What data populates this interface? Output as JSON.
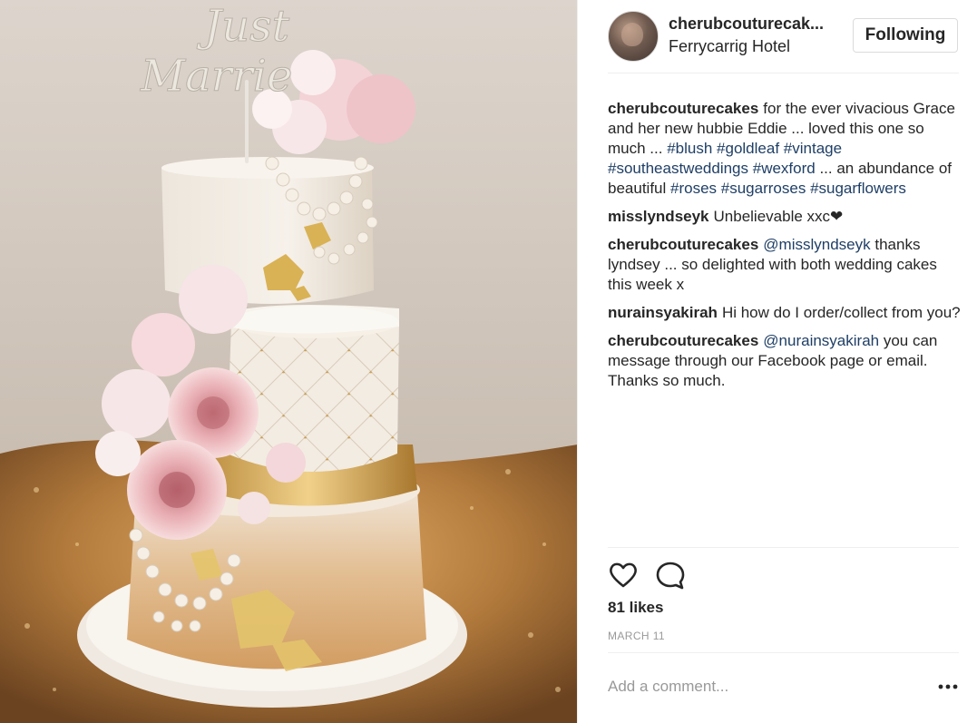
{
  "header": {
    "username": "cherubcouturecak...",
    "location": "Ferrycarrig Hotel",
    "follow_label": "Following",
    "avatar_icon": "profile-photo"
  },
  "photo": {
    "topper_text": "Just Married",
    "description_icon": "wedding-cake-photo"
  },
  "comments": [
    {
      "user": "cherubcouturecakes",
      "parts": [
        {
          "text": "for the ever vivacious Grace and her new hubbie Eddie ... loved this one so much ... "
        },
        {
          "tag": "#blush"
        },
        {
          "text": " "
        },
        {
          "tag": "#goldleaf"
        },
        {
          "text": " "
        },
        {
          "tag": "#vintage"
        },
        {
          "text": " "
        },
        {
          "tag": "#southeastweddings"
        },
        {
          "text": " "
        },
        {
          "tag": "#wexford"
        },
        {
          "text": " ... an abundance of beautiful "
        },
        {
          "tag": "#roses"
        },
        {
          "text": " "
        },
        {
          "tag": "#sugarroses"
        },
        {
          "text": " "
        },
        {
          "tag": "#sugarflowers"
        }
      ]
    },
    {
      "user": "misslyndseyk",
      "parts": [
        {
          "text": "Unbelievable xxc❤"
        }
      ]
    },
    {
      "user": "cherubcouturecakes",
      "parts": [
        {
          "mention": "@misslyndseyk"
        },
        {
          "text": " thanks lyndsey ... so delighted with both wedding cakes this week x"
        }
      ]
    },
    {
      "user": "nurainsyakirah",
      "parts": [
        {
          "text": "Hi how do I order/collect from you?"
        }
      ]
    },
    {
      "user": "cherubcouturecakes",
      "parts": [
        {
          "mention": "@nurainsyakirah"
        },
        {
          "text": " you can message through our Facebook page or email. Thanks so much."
        }
      ]
    }
  ],
  "actions": {
    "like_icon": "heart-icon",
    "comment_icon": "comment-bubble-icon",
    "likes_text": "81 likes",
    "date_text": "MARCH 11"
  },
  "add_comment": {
    "placeholder": "Add a comment...",
    "more_icon": "more-options-icon"
  },
  "colors": {
    "text": "#262626",
    "hashtag": "#1f3f66",
    "muted": "#999999",
    "divider": "#efefef",
    "border": "#dbdbdb"
  }
}
